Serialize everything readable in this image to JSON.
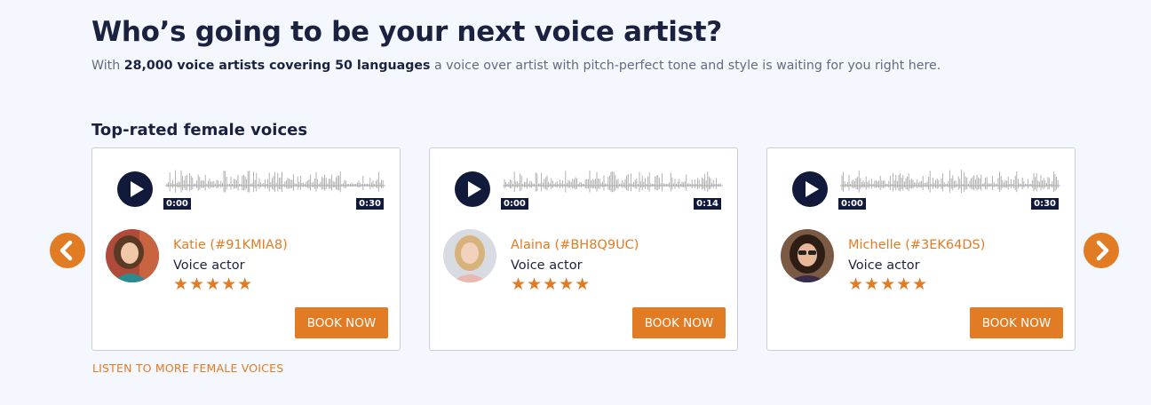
{
  "header": {
    "title": "Who’s going to be your next voice artist?",
    "subtitle_prefix": "With ",
    "subtitle_bold": "28,000 voice artists covering 50 languages",
    "subtitle_suffix": " a voice over artist with pitch-perfect tone and style is waiting for you right here."
  },
  "section": {
    "title": "Top-rated female voices"
  },
  "cards": [
    {
      "name": "Katie (#91KMIA8)",
      "role": "Voice actor",
      "stars": "★★★★★",
      "rating": 5,
      "time_start": "0:00",
      "time_end": "0:30",
      "button": "BOOK NOW",
      "avatar_hair": "#5a3a24",
      "avatar_bg": "#b04a3a"
    },
    {
      "name": "Alaina (#BH8Q9UC)",
      "role": "Voice actor",
      "stars": "★★★★★",
      "rating": 5,
      "time_start": "0:00",
      "time_end": "0:14",
      "button": "BOOK NOW",
      "avatar_hair": "#d7b27a",
      "avatar_bg": "#d9dbe2"
    },
    {
      "name": "Michelle (#3EK64DS)",
      "role": "Voice actor",
      "stars": "★★★★★",
      "rating": 5,
      "time_start": "0:00",
      "time_end": "0:30",
      "button": "BOOK NOW",
      "avatar_hair": "#2e1d14",
      "avatar_bg": "#7a5a44"
    }
  ],
  "nav": {
    "prev_icon": "chevron-left-icon",
    "next_icon": "chevron-right-icon"
  },
  "footer_link": "LISTEN TO MORE FEMALE VOICES",
  "colors": {
    "accent": "#e17c25",
    "navy": "#111a3a",
    "background": "#f4f7fd"
  }
}
